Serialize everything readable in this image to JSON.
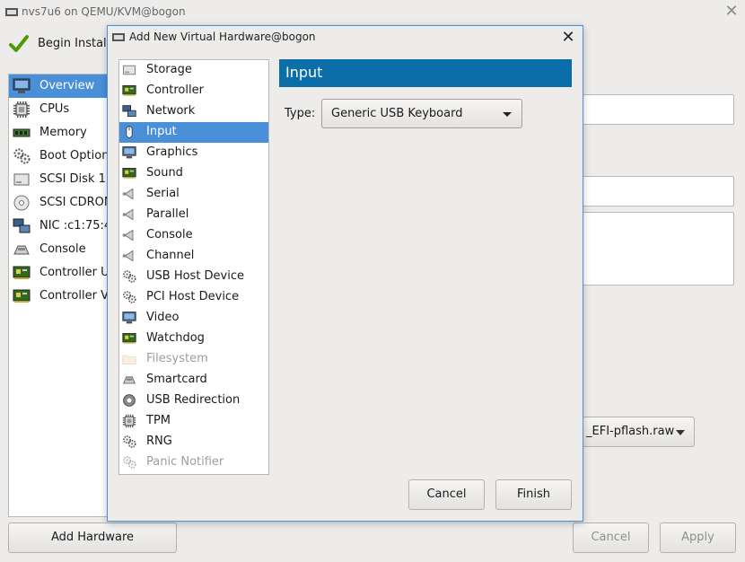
{
  "main_window": {
    "title": "nvs7u6 on QEMU/KVM@bogon",
    "begin_install_label": "Begin Instal",
    "hardware_items": [
      {
        "label": "Overview",
        "icon": "monitor-icon",
        "selected": true
      },
      {
        "label": "CPUs",
        "icon": "cpu-chip-icon"
      },
      {
        "label": "Memory",
        "icon": "memory-module-icon"
      },
      {
        "label": "Boot Option",
        "icon": "gears-icon"
      },
      {
        "label": "SCSI Disk 1",
        "icon": "disk-drive-icon"
      },
      {
        "label": "SCSI CDROM",
        "icon": "cdrom-icon"
      },
      {
        "label": "NIC :c1:75:4",
        "icon": "network-icon"
      },
      {
        "label": "Console",
        "icon": "console-icon"
      },
      {
        "label": "Controller U",
        "icon": "controller-card-icon"
      },
      {
        "label": "Controller V",
        "icon": "controller-card-icon"
      }
    ],
    "firmware_value": "_EFI-pflash.raw",
    "add_hardware_label": "Add Hardware",
    "cancel_label": "Cancel",
    "apply_label": "Apply"
  },
  "dialog": {
    "title": "Add New Virtual Hardware@bogon",
    "devices": [
      {
        "label": "Storage",
        "icon": "storage-icon"
      },
      {
        "label": "Controller",
        "icon": "controller-card-icon"
      },
      {
        "label": "Network",
        "icon": "network-icon"
      },
      {
        "label": "Input",
        "icon": "mouse-icon",
        "selected": true
      },
      {
        "label": "Graphics",
        "icon": "monitor-icon"
      },
      {
        "label": "Sound",
        "icon": "sound-card-icon"
      },
      {
        "label": "Serial",
        "icon": "serial-plug-icon"
      },
      {
        "label": "Parallel",
        "icon": "parallel-plug-icon"
      },
      {
        "label": "Console",
        "icon": "console-plug-icon"
      },
      {
        "label": "Channel",
        "icon": "channel-plug-icon"
      },
      {
        "label": "USB Host Device",
        "icon": "usb-device-icon"
      },
      {
        "label": "PCI Host Device",
        "icon": "pci-device-icon"
      },
      {
        "label": "Video",
        "icon": "video-monitor-icon"
      },
      {
        "label": "Watchdog",
        "icon": "watchdog-icon"
      },
      {
        "label": "Filesystem",
        "icon": "folder-icon",
        "disabled": true
      },
      {
        "label": "Smartcard",
        "icon": "smartcard-icon"
      },
      {
        "label": "USB Redirection",
        "icon": "usb-redirection-icon"
      },
      {
        "label": "TPM",
        "icon": "tpm-chip-icon"
      },
      {
        "label": "RNG",
        "icon": "rng-icon"
      },
      {
        "label": "Panic Notifier",
        "icon": "panic-notifier-icon",
        "disabled": true
      }
    ],
    "page_title": "Input",
    "type_label": "Type:",
    "type_value": "Generic USB Keyboard",
    "cancel_label": "Cancel",
    "finish_label": "Finish"
  },
  "colors": {
    "selection": "#4a90d9",
    "header": "#0c6ea8",
    "window_bg": "#edeceb"
  }
}
